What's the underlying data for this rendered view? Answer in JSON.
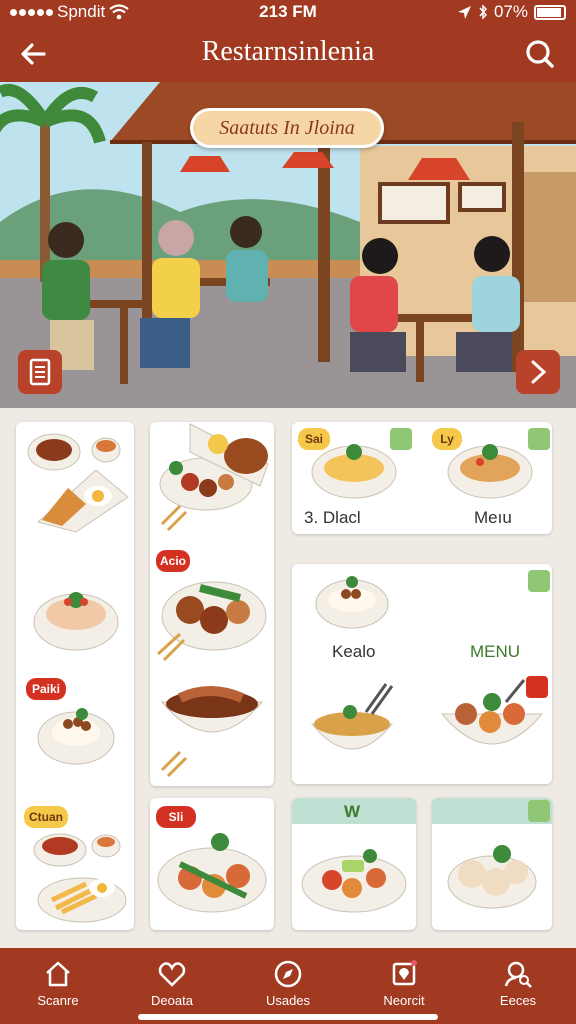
{
  "status_bar": {
    "carrier": "Spndit",
    "time": "213 FM",
    "battery": "07%"
  },
  "header": {
    "title": "Restarnsinlenia"
  },
  "hero": {
    "badge": "Saatuts In Jloina"
  },
  "menu_grid": {
    "card_labels": {
      "noodle_dish": "3. Dlacl",
      "noodle_menu": "Meıu",
      "kealo": "Kealo",
      "menu": "MENU"
    },
    "badges": {
      "badge_a": "Paiki",
      "badge_b": "Acio",
      "badge_c": "Sai",
      "badge_d": "Ctuan",
      "badge_e": "Sli",
      "badge_f": "Ly",
      "badge_g": "W"
    }
  },
  "bottom_nav": {
    "items": [
      {
        "label": "Scanre",
        "icon": "home-icon"
      },
      {
        "label": "Deoata",
        "icon": "heart-icon"
      },
      {
        "label": "Usades",
        "icon": "compass-icon"
      },
      {
        "label": "Neorcit",
        "icon": "map-pin-icon"
      },
      {
        "label": "Eeces",
        "icon": "user-search-icon"
      }
    ]
  },
  "colors": {
    "brand": "#a23a22",
    "accent": "#f7d6a6",
    "leaf": "#8fc775"
  }
}
